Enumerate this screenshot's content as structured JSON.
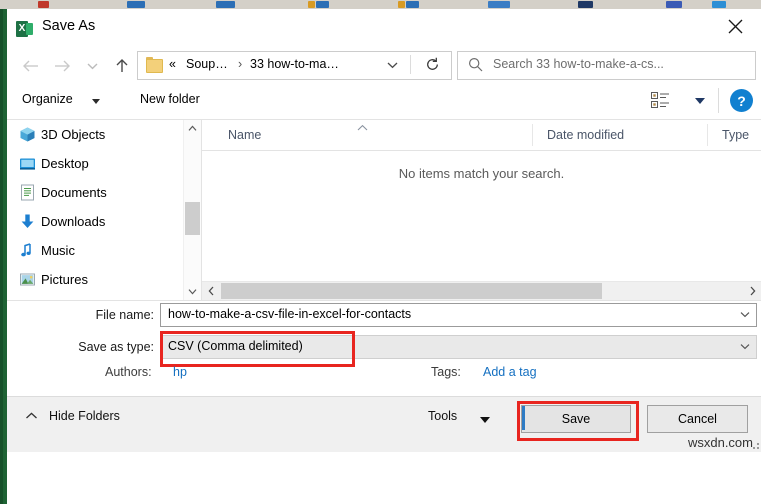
{
  "window": {
    "title": "Save As",
    "app_icon": "excel-icon",
    "app_icon_letter": "X",
    "close_label": "✕",
    "accent_green": "#1e7145",
    "annotation_color": "#e8251f",
    "link_color": "#1570c1"
  },
  "navigation": {
    "back_label": "←",
    "forward_label": "→",
    "recent_label": "⌄",
    "up_label": "↑",
    "breadcrumb": {
      "overflow": "«",
      "separator": "›",
      "parent": "Soup…",
      "current": "33 how-to-ma…"
    },
    "refresh_label": "↻"
  },
  "search": {
    "placeholder": "Search 33 how-to-make-a-cs...",
    "icon": "search-icon"
  },
  "toolbar": {
    "organize_label": "Organize",
    "new_folder_label": "New folder",
    "view_icon": "view-options-icon",
    "help_label": "?"
  },
  "sidebar": {
    "items": [
      {
        "label": "3D Objects",
        "icon": "3d-objects-icon"
      },
      {
        "label": "Desktop",
        "icon": "desktop-icon"
      },
      {
        "label": "Documents",
        "icon": "documents-icon"
      },
      {
        "label": "Downloads",
        "icon": "downloads-icon"
      },
      {
        "label": "Music",
        "icon": "music-icon"
      },
      {
        "label": "Pictures",
        "icon": "pictures-icon"
      }
    ],
    "scroll_up": "∧",
    "scroll_down": "∨"
  },
  "filelist": {
    "columns": [
      {
        "label": "Name"
      },
      {
        "label": "Date modified"
      },
      {
        "label": "Type"
      }
    ],
    "sort_indicator": "∧",
    "empty_message": "No items match your search.",
    "scroll_left": "‹",
    "scroll_right": "›"
  },
  "form": {
    "file_name_label": "File name:",
    "file_name_value": "how-to-make-a-csv-file-in-excel-for-contacts",
    "save_type_label": "Save as type:",
    "save_type_value": "CSV (Comma delimited)",
    "dropdown_icon": "chevron-down-icon",
    "authors_label": "Authors:",
    "authors_value": "hp",
    "tags_label": "Tags:",
    "tags_value": "Add a tag"
  },
  "footer": {
    "hide_folders_label": "Hide Folders",
    "hide_folders_icon": "chevron-up-icon",
    "tools_label": "Tools",
    "save_label": "Save",
    "cancel_label": "Cancel"
  },
  "watermark": {
    "text": "wsxdn.com"
  }
}
